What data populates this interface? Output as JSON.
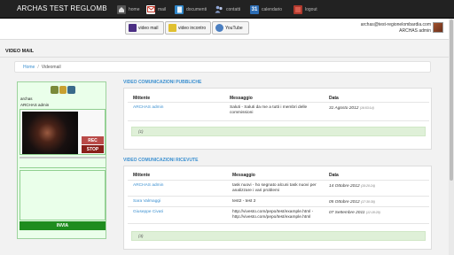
{
  "navbar": {
    "brand": "ARCHAS TEST REGLOMB",
    "items": [
      {
        "label": "home",
        "icon": "house-icon",
        "color": "#555555"
      },
      {
        "label": "mail",
        "icon": "envelope-icon",
        "color": "#c0392b"
      },
      {
        "label": "documenti",
        "icon": "document-icon",
        "color": "#2f86c9"
      },
      {
        "label": "contatti",
        "icon": "people-icon",
        "color": "#5b6e9c"
      },
      {
        "label": "calendario",
        "icon": "calendar-icon",
        "color": "#2c6db5",
        "glyph": "31"
      },
      {
        "label": "logout",
        "icon": "logout-icon",
        "color": "#b03a2e"
      }
    ]
  },
  "toolbar": {
    "buttons": [
      {
        "label": "video mail",
        "icon": "video-mail-icon",
        "color": "#4b2e83"
      },
      {
        "label": "video incontro",
        "icon": "video-meeting-icon",
        "color": "#e0c030"
      },
      {
        "label": "YouTube",
        "icon": "youtube-icon",
        "color": "#4b7fc1"
      }
    ]
  },
  "user": {
    "email": "archas@test-regionelombardia.com",
    "name": "ARCHAS admin"
  },
  "page_title": "VIDEO MAIL",
  "breadcrumb": {
    "home": "Home",
    "separator": "/",
    "current": "Videomail"
  },
  "sidebar": {
    "line1": "archas",
    "line2": "ARCHAS admin",
    "rec_label": "REC",
    "stop_label": "STOP",
    "send_label": "INVIA"
  },
  "public": {
    "title": "VIDEO COMUNICAZIONI PUBBLICHE",
    "headers": [
      "Mittente",
      "Messaggio",
      "Data"
    ],
    "rows": [
      {
        "sender": "ARCHAS admin",
        "message_lines": [
          "Saluti - Saluti da me a tutti i membri delle",
          "commissioni"
        ],
        "date": "31 Agosto 2012",
        "time": "(16:53:14)"
      }
    ],
    "count": "(1)"
  },
  "received": {
    "title": "VIDEO COMUNICAZIONI RICEVUTE",
    "headers": [
      "Mittente",
      "Messaggio",
      "Data"
    ],
    "rows": [
      {
        "sender": "ARCHAS admin",
        "message_lines": [
          "task nuovi - ho segnato alcuni task nuovi per",
          "analizzare i vari problemi"
        ],
        "date": "14 Ottobre 2012",
        "time": "(15:20:24)"
      },
      {
        "sender": "Sara Valmaggi",
        "message_lines": [
          "test2 - test 2"
        ],
        "date": "05 Ottobre 2012",
        "time": "(17:30:30)"
      },
      {
        "sender": "Giuseppe Civati",
        "message_lines": [
          "http://vivesto.com/pepo/test/example.html -",
          "http://vivesto.com/pepo/test/example.html"
        ],
        "date": "07 Settembre 2011",
        "time": "(12:18:29)"
      }
    ],
    "count": "(3)"
  }
}
